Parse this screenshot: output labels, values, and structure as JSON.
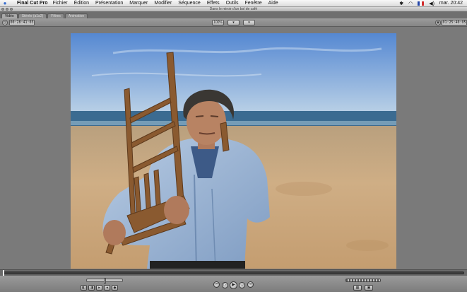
{
  "menubar": {
    "apple_icon": "apple-icon",
    "app_name": "Final Cut Pro",
    "items": [
      "Fichier",
      "Édition",
      "Présentation",
      "Marquer",
      "Modifier",
      "Séquence",
      "Effets",
      "Outils",
      "Fenêtre",
      "Aide"
    ],
    "clock": "mar. 20:42",
    "status_icons": [
      "bluetooth-icon",
      "wifi-icon",
      "french-flag-icon",
      "volume-icon"
    ]
  },
  "window": {
    "title": "Dans le miroir d'un bol de café",
    "tabs": [
      {
        "label": "Vidéo",
        "active": true
      },
      {
        "label": "Stéréo (a1a2)",
        "active": false
      },
      {
        "label": "Filtres",
        "active": false
      },
      {
        "label": "Animation",
        "active": false
      }
    ]
  },
  "toolbar": {
    "duration_timecode": "00:28:41:03",
    "current_timecode": "01:25:40:05",
    "zoom_label": "100%",
    "view_label": "▾",
    "overlay_label": "▾"
  },
  "transport": {
    "buttons": [
      "in-point",
      "out-point",
      "previous-edit",
      "play-in-to-out",
      "play",
      "play-around",
      "next-edit"
    ],
    "right_buttons": [
      "match-frame-icon",
      "marker-icon"
    ]
  },
  "colors": {
    "sky_top": "#5a8ed6",
    "sea": "#3f6d93",
    "sand": "#c9a479",
    "shirt": "#9fb8d6",
    "chair": "#8a5a2e"
  }
}
